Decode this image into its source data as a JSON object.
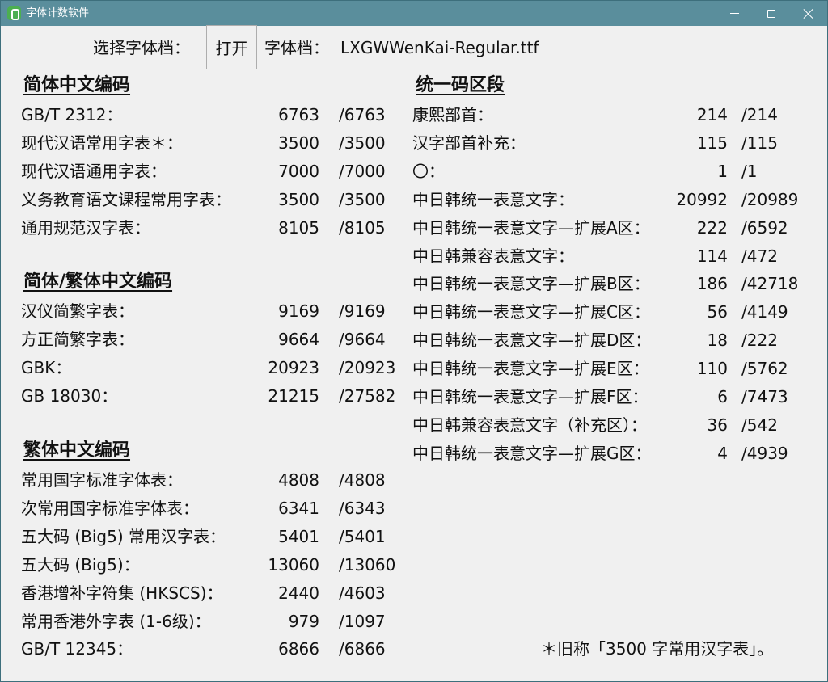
{
  "window": {
    "title": "字体计数软件",
    "icon": "app-icon"
  },
  "toolbar": {
    "choose_label": "选择字体档：",
    "open_button": "打开",
    "font_file_label": "字体档：",
    "font_file_name": "LXGWWenKai-Regular.ttf"
  },
  "sections": {
    "simplified": {
      "title": "简体中文编码",
      "rows": [
        {
          "label": "GB/T 2312：",
          "count": "6763",
          "total": "/6763"
        },
        {
          "label": "现代汉语常用字表＊：",
          "count": "3500",
          "total": "/3500"
        },
        {
          "label": "现代汉语通用字表：",
          "count": "7000",
          "total": "/7000"
        },
        {
          "label": "义务教育语文课程常用字表：",
          "count": "3500",
          "total": "/3500"
        },
        {
          "label": "通用规范汉字表：",
          "count": "8105",
          "total": "/8105"
        }
      ]
    },
    "mixed": {
      "title": "简体/繁体中文编码",
      "rows": [
        {
          "label": "汉仪简繁字表：",
          "count": "9169",
          "total": "/9169"
        },
        {
          "label": "方正简繁字表：",
          "count": "9664",
          "total": "/9664"
        },
        {
          "label": "GBK：",
          "count": "20923",
          "total": "/20923"
        },
        {
          "label": "GB 18030：",
          "count": "21215",
          "total": "/27582"
        }
      ]
    },
    "traditional": {
      "title": "繁体中文编码",
      "rows": [
        {
          "label": "常用国字标准字体表：",
          "count": "4808",
          "total": "/4808"
        },
        {
          "label": "次常用国字标准字体表：",
          "count": "6341",
          "total": "/6343"
        },
        {
          "label": "五大码 (Big5) 常用汉字表：",
          "count": "5401",
          "total": "/5401"
        },
        {
          "label": "五大码 (Big5)：",
          "count": "13060",
          "total": "/13060"
        },
        {
          "label": "香港增补字符集 (HKSCS)：",
          "count": "2440",
          "total": "/4603"
        },
        {
          "label": "常用香港外字表 (1-6级)：",
          "count": "979",
          "total": "/1097"
        },
        {
          "label": "GB/T 12345：",
          "count": "6866",
          "total": "/6866"
        }
      ]
    },
    "unicode": {
      "title": "统一码区段",
      "rows": [
        {
          "label": "康熙部首：",
          "count": "214",
          "total": "/214"
        },
        {
          "label": "汉字部首补充：",
          "count": "115",
          "total": "/115"
        },
        {
          "label": "〇：",
          "count": "1",
          "total": "/1"
        },
        {
          "label": "中日韩统一表意文字：",
          "count": "20992",
          "total": "/20989"
        },
        {
          "label": "中日韩统一表意文字—扩展A区：",
          "count": "222",
          "total": "/6592"
        },
        {
          "label": "中日韩兼容表意文字：",
          "count": "114",
          "total": "/472"
        },
        {
          "label": "中日韩统一表意文字—扩展B区：",
          "count": "186",
          "total": "/42718"
        },
        {
          "label": "中日韩统一表意文字—扩展C区：",
          "count": "56",
          "total": "/4149"
        },
        {
          "label": "中日韩统一表意文字—扩展D区：",
          "count": "18",
          "total": "/222"
        },
        {
          "label": "中日韩统一表意文字—扩展E区：",
          "count": "110",
          "total": "/5762"
        },
        {
          "label": "中日韩统一表意文字—扩展F区：",
          "count": "6",
          "total": "/7473"
        },
        {
          "label": "中日韩兼容表意文字（补充区）：",
          "count": "36",
          "total": "/542"
        },
        {
          "label": "中日韩统一表意文字—扩展G区：",
          "count": "4",
          "total": "/4939"
        }
      ]
    }
  },
  "footnote": "＊旧称「3500 字常用汉字表」。",
  "colors": {
    "titlebar": "#5a8e9c",
    "background": "#f0f0f0",
    "text": "#111111"
  }
}
